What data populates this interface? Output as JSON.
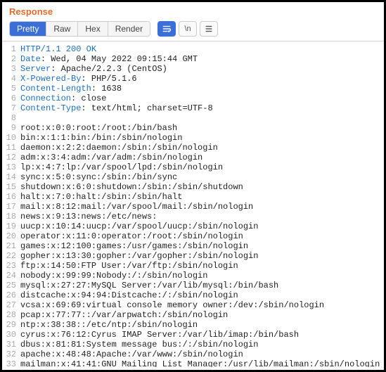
{
  "header": {
    "title": "Response"
  },
  "tabs": {
    "items": [
      "Pretty",
      "Raw",
      "Hex",
      "Render"
    ],
    "active_index": 0
  },
  "toolbar": {
    "btn_wrap_name": "wrap-toggle-icon",
    "btn_newline_label": "\\n",
    "btn_menu_name": "menu-icon"
  },
  "response": {
    "status_line": "HTTP/1.1 200 OK",
    "headers": [
      {
        "name": "Date",
        "value": "Wed, 04 May 2022 09:15:44 GMT"
      },
      {
        "name": "Server",
        "value": "Apache/2.2.3 (CentOS)"
      },
      {
        "name": "X-Powered-By",
        "value": "PHP/5.1.6"
      },
      {
        "name": "Content-Length",
        "value": "1638"
      },
      {
        "name": "Connection",
        "value": "close"
      },
      {
        "name": "Content-Type",
        "value": "text/html; charset=UTF-8"
      }
    ],
    "body_lines": [
      "",
      "root:x:0:0:root:/root:/bin/bash",
      "bin:x:1:1:bin:/bin:/sbin/nologin",
      "daemon:x:2:2:daemon:/sbin:/sbin/nologin",
      "adm:x:3:4:adm:/var/adm:/sbin/nologin",
      "lp:x:4:7:lp:/var/spool/lpd:/sbin/nologin",
      "sync:x:5:0:sync:/sbin:/bin/sync",
      "shutdown:x:6:0:shutdown:/sbin:/sbin/shutdown",
      "halt:x:7:0:halt:/sbin:/sbin/halt",
      "mail:x:8:12:mail:/var/spool/mail:/sbin/nologin",
      "news:x:9:13:news:/etc/news:",
      "uucp:x:10:14:uucp:/var/spool/uucp:/sbin/nologin",
      "operator:x:11:0:operator:/root:/sbin/nologin",
      "games:x:12:100:games:/usr/games:/sbin/nologin",
      "gopher:x:13:30:gopher:/var/gopher:/sbin/nologin",
      "ftp:x:14:50:FTP User:/var/ftp:/sbin/nologin",
      "nobody:x:99:99:Nobody:/:/sbin/nologin",
      "mysql:x:27:27:MySQL Server:/var/lib/mysql:/bin/bash",
      "distcache:x:94:94:Distcache:/:/sbin/nologin",
      "vcsa:x:69:69:virtual console memory owner:/dev:/sbin/nologin",
      "pcap:x:77:77::/var/arpwatch:/sbin/nologin",
      "ntp:x:38:38::/etc/ntp:/sbin/nologin",
      "cyrus:x:76:12:Cyrus IMAP Server:/var/lib/imap:/bin/bash",
      "dbus:x:81:81:System message bus:/:/sbin/nologin",
      "apache:x:48:48:Apache:/var/www:/sbin/nologin",
      "mailman:x:41:41:GNU Mailing List Manager:/usr/lib/mailman:/sbin/nologin"
    ]
  }
}
